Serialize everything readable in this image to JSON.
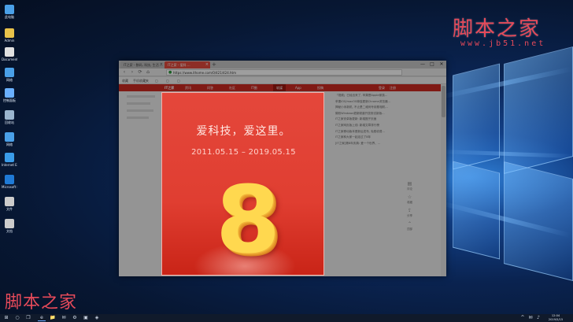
{
  "desktop": {
    "icons": [
      {
        "label": "此电脑",
        "color": "#4aa0e8"
      },
      {
        "label": "Admin",
        "color": "#e8c24a"
      },
      {
        "label": "Document",
        "color": "#e0e0e0"
      },
      {
        "label": "网络",
        "color": "#4aa0e8"
      },
      {
        "label": "控制面板",
        "color": "#6ab0ff"
      },
      {
        "label": "回收站",
        "color": "#9ab5cf"
      },
      {
        "label": "网络",
        "color": "#4aa0e8"
      },
      {
        "label": "Internet Explorer",
        "color": "#3a9ce8"
      },
      {
        "label": "Microsoft Edge",
        "color": "#1f7ad6"
      },
      {
        "label": "文件",
        "color": "#cccccc"
      },
      {
        "label": "文档",
        "color": "#cccccc"
      }
    ]
  },
  "watermark": {
    "top_cn": "脚本之家",
    "top_url": "www.jb51.net",
    "bottom_cn": "脚本之家"
  },
  "browser": {
    "tabs": [
      {
        "label": "IT之家 - 数码, 科技, 生活 ..."
      },
      {
        "label": "IT之家 - 爱科 ..."
      }
    ],
    "newtab": "+",
    "window_controls": {
      "min": "—",
      "max": "□",
      "close": "✕"
    },
    "toolbar": {
      "back": "‹",
      "forward": "›",
      "reload": "⟳",
      "home": "⌂"
    },
    "address": "https://www.ithome.com/0/421/424.htm",
    "bookmarks": [
      "收藏",
      "手机收藏夹",
      "▢",
      "▢",
      "▢",
      "▢"
    ]
  },
  "page": {
    "nav": {
      "logo": "IT之家",
      "items": [
        "资讯",
        "问答",
        "社区",
        "IT圈",
        "软媒",
        "App",
        "投稿"
      ],
      "active": "软媒",
      "right_items": [
        "登录",
        "注册"
      ]
    },
    "news": [
      "「视频」已经出来了, 苹果是Apple家族...",
      "苹果iOS/macOS单独更新Chrome浏览器...",
      "揭秘小米新机, 不止是二维码专用照相机...",
      "微软Windows更新频道开放测试新版...",
      "IT之家安卓版更新: 新增圈子页面",
      "IT之家网页版上线: 新增文章排行榜",
      "IT之家移动版本更新后发布, 免费收费...",
      "IT之家和大家一起走过了8年",
      "[IT之家]第8年庆典: 爱一个世界、..."
    ],
    "rail": [
      {
        "icon": "▤",
        "label": "评论"
      },
      {
        "icon": "☆",
        "label": "收藏"
      },
      {
        "icon": "⇪",
        "label": "分享"
      },
      {
        "icon": "⌃",
        "label": "顶部"
      }
    ]
  },
  "popup": {
    "slogan": "爱科技，爱这里。",
    "dates": "2011.05.15 – 2019.05.15",
    "big_number": "8"
  },
  "taskbar": {
    "start": "⊞",
    "search": "○",
    "taskview": "❐",
    "apps": [
      "e",
      "📁",
      "✉",
      "⚙",
      "▣",
      "◈"
    ],
    "time": "12:04",
    "date": "2019/5/15",
    "tray": [
      "^",
      "✉",
      "♪"
    ]
  }
}
